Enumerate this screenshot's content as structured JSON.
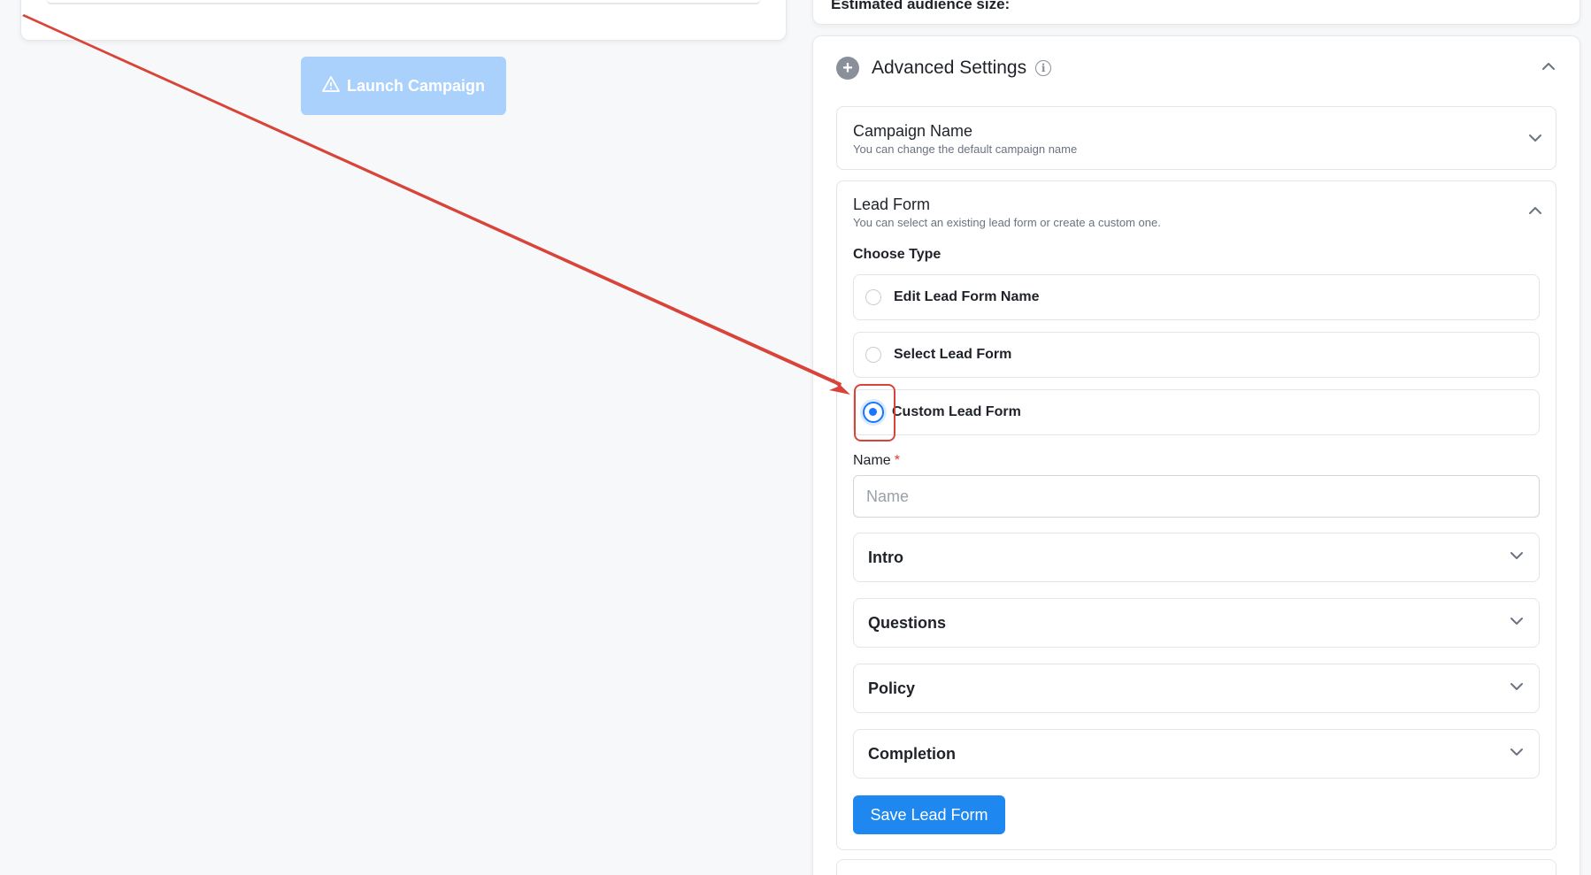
{
  "left": {
    "launch_button_label": "Launch Campaign"
  },
  "top_strip": {
    "text": "Estimated audience size:"
  },
  "advanced_settings": {
    "title": "Advanced Settings",
    "campaign_name": {
      "title": "Campaign Name",
      "subtitle": "You can change the default campaign name"
    },
    "lead_form": {
      "title": "Lead Form",
      "subtitle": "You can select an existing lead form or create a custom one.",
      "choose_type_label": "Choose Type",
      "options": [
        {
          "label": "Edit Lead Form Name",
          "checked": false
        },
        {
          "label": "Select Lead Form",
          "checked": false
        },
        {
          "label": "Custom Lead Form",
          "checked": true
        }
      ],
      "name_label": "Name",
      "name_required_mark": "*",
      "name_placeholder": "Name",
      "name_value": "",
      "collapsibles": [
        {
          "label": "Intro"
        },
        {
          "label": "Questions"
        },
        {
          "label": "Policy"
        },
        {
          "label": "Completion"
        }
      ],
      "save_button_label": "Save Lead Form"
    }
  },
  "colors": {
    "primary": "#1e87f0",
    "launch_disabled": "#a9d1fb",
    "annotation": "#d9443a",
    "radio_checked": "#1677ff"
  },
  "icons": {
    "launch": "warning-triangle-icon",
    "advanced": "plus-circle-icon",
    "info": "info-icon",
    "chevron_up": "chevron-up-icon",
    "chevron_down": "chevron-down-icon"
  }
}
